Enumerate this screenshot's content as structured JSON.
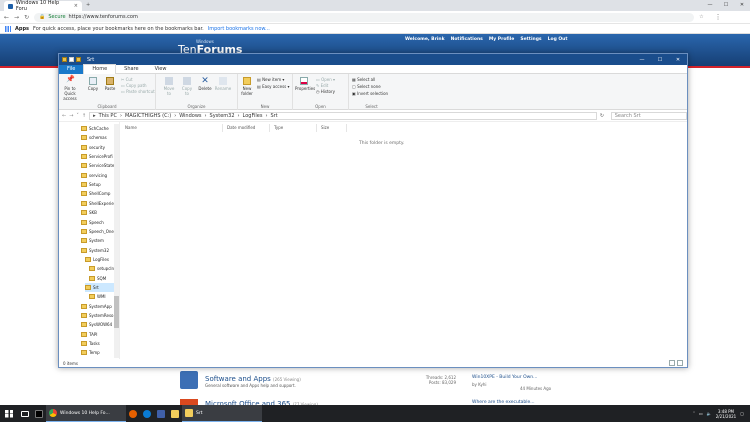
{
  "browser": {
    "tab_title": "Windows 10 Help Foru",
    "tab_close": "×",
    "new_tab": "+",
    "win_min": "—",
    "win_max": "☐",
    "win_close": "✕",
    "secure_label": "Secure",
    "url": "https://www.tenforums.com",
    "bookmarks_apps": "Apps",
    "bookmarks_message": "For quick access, place your bookmarks here on the bookmarks bar.",
    "bookmarks_link": "Import bookmarks now..."
  },
  "site": {
    "logo_small": "Windows",
    "logo_big_1": "Ten",
    "logo_big_2": "Forums",
    "nav": [
      "Welcome, Brink",
      "Notifications",
      "My Profile",
      "Settings",
      "Log Out"
    ]
  },
  "explorer": {
    "title": "Srt",
    "tabs": {
      "file": "File",
      "home": "Home",
      "share": "Share",
      "view": "View"
    },
    "ribbon": {
      "clipboard": {
        "label": "Clipboard",
        "pin": "Pin to Quick access",
        "copy": "Copy",
        "paste": "Paste",
        "cut": "Cut",
        "copy_path": "Copy path",
        "paste_shortcut": "Paste shortcut"
      },
      "organize": {
        "label": "Organize",
        "move_to": "Move to",
        "copy_to": "Copy to",
        "delete": "Delete",
        "rename": "Rename"
      },
      "new": {
        "label": "New",
        "new_folder": "New folder",
        "new_item": "New item ▾",
        "easy_access": "Easy access ▾"
      },
      "open": {
        "label": "Open",
        "properties": "Properties",
        "open": "Open ▾",
        "edit": "Edit",
        "history": "History"
      },
      "select": {
        "label": "Select",
        "select_all": "Select all",
        "select_none": "Select none",
        "invert": "Invert selection"
      }
    },
    "address": {
      "parts": [
        "This PC",
        "MAGICTHIGHS (C:)",
        "Windows",
        "System32",
        "LogFiles",
        "Srt"
      ],
      "search_placeholder": "Search Srt"
    },
    "tree": [
      "SchCache",
      "schemas",
      "security",
      "ServiceProfi",
      "ServiceState",
      "servicing",
      "Setup",
      "ShellComp",
      "ShellExperie",
      "SKB",
      "Speech",
      "Speech_One",
      "System",
      "System32",
      "LogFiles",
      "setupcln",
      "SQM",
      "Srt",
      "WMI",
      "SystemApp",
      "SystemReso",
      "SysWOW64",
      "TAPI",
      "Tasks",
      "Temp"
    ],
    "columns": [
      "Name",
      "Date modified",
      "Type",
      "Size"
    ],
    "empty_message": "This folder is empty.",
    "status": "0 items"
  },
  "forum": {
    "title": "Software and Apps",
    "viewing": "(265 Viewing)",
    "subtitle": "General software and Apps help and support.",
    "threads": "Threads: 2,612",
    "posts": "Posts: 83,029",
    "last_post": "Win10XPE - Build Your Own...",
    "last_by": "by Kyhi",
    "last_time": "44 Minutes Ago",
    "next_title": "Microsoft Office and 365",
    "next_viewing": "(77 Viewing)",
    "next_post": "Where are the executable..."
  },
  "taskbar": {
    "items": [
      "Windows 10 Help Fo...",
      "Srt"
    ],
    "time": "3:48 PM",
    "date": "2/21/2021"
  }
}
